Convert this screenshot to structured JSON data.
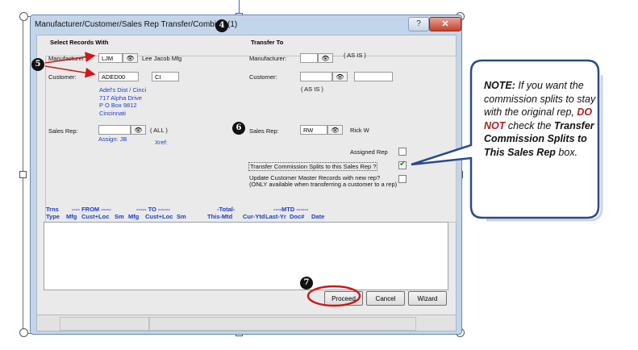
{
  "window": {
    "title": "Manufacturer/Customer/Sales Rep Transfer/Combine (1)",
    "help_label": "?",
    "close_label": "✕"
  },
  "select_records": {
    "group_label": "Select Records With",
    "manufacturer_label": "Manufacturer:",
    "manufacturer_value": "LJM",
    "manufacturer_name": "Lee Jacob Mfg",
    "customer_label": "Customer:",
    "customer_value": "ADED00",
    "customer_loc": "CI",
    "address": [
      "Adel's Dist / Cinci",
      "717 Alpha Drive",
      "P O Box 9812",
      "Cincinnati"
    ],
    "sales_rep_label": "Sales Rep:",
    "sales_rep_value": "",
    "sales_rep_all": "( ALL )",
    "assign": "Assign: JB",
    "xref": "Xref:"
  },
  "transfer_to": {
    "group_label": "Transfer To",
    "manufacturer_label": "Manufacturer:",
    "manufacturer_value": "",
    "manufacturer_asis": "( AS IS )",
    "customer_label": "Customer:",
    "customer_value": "",
    "customer_loc": "",
    "customer_asis": "( AS IS )",
    "sales_rep_label": "Sales Rep:",
    "sales_rep_value": "RW",
    "sales_rep_name": "Rick W",
    "assigned_rep_label": "Assigned Rep",
    "assigned_rep_checked": false,
    "transfer_splits_label": "Transfer Commission Splits to this Sales Rep ?",
    "transfer_splits_checked": true,
    "update_master_label": "Update Customer Master Records with new rep?",
    "update_master_note": "(ONLY available when transferring a customer to a rep)",
    "update_master_checked": false
  },
  "table_headers": {
    "row1": {
      "trns": "Trns",
      "from": "---- FROM -----",
      "to": "----- TO ------",
      "total": "-Total-",
      "mtd": "----MTD ------"
    },
    "row2": [
      "Type",
      "Mfg",
      "Cust+Loc",
      "Sm",
      "Mfg",
      "Cust+Loc",
      "Sm",
      "This-Mtd",
      "Cur-Ytd",
      "Last-Yr",
      "Doc#",
      "Date"
    ]
  },
  "buttons": {
    "proceed": "Proceed",
    "cancel": "Cancel",
    "wizard": "Wizard"
  },
  "markers": {
    "m4": "4",
    "m5": "5",
    "m6": "6",
    "m7": "7"
  },
  "note": {
    "lead": "NOTE:",
    "text1": " If you want the commission splits to stay with the original rep, ",
    "do_not": "DO NOT",
    "text2": " check the ",
    "bold_target": "Transfer Commission Splits to This Sales Rep",
    "text3": " box."
  },
  "colors": {
    "window_frame": "#c3d5ea",
    "close_button": "#c5412d",
    "label_blue": "#1a3ccf",
    "annotation_red": "#d01818",
    "callout_border": "#2a4a8a"
  }
}
